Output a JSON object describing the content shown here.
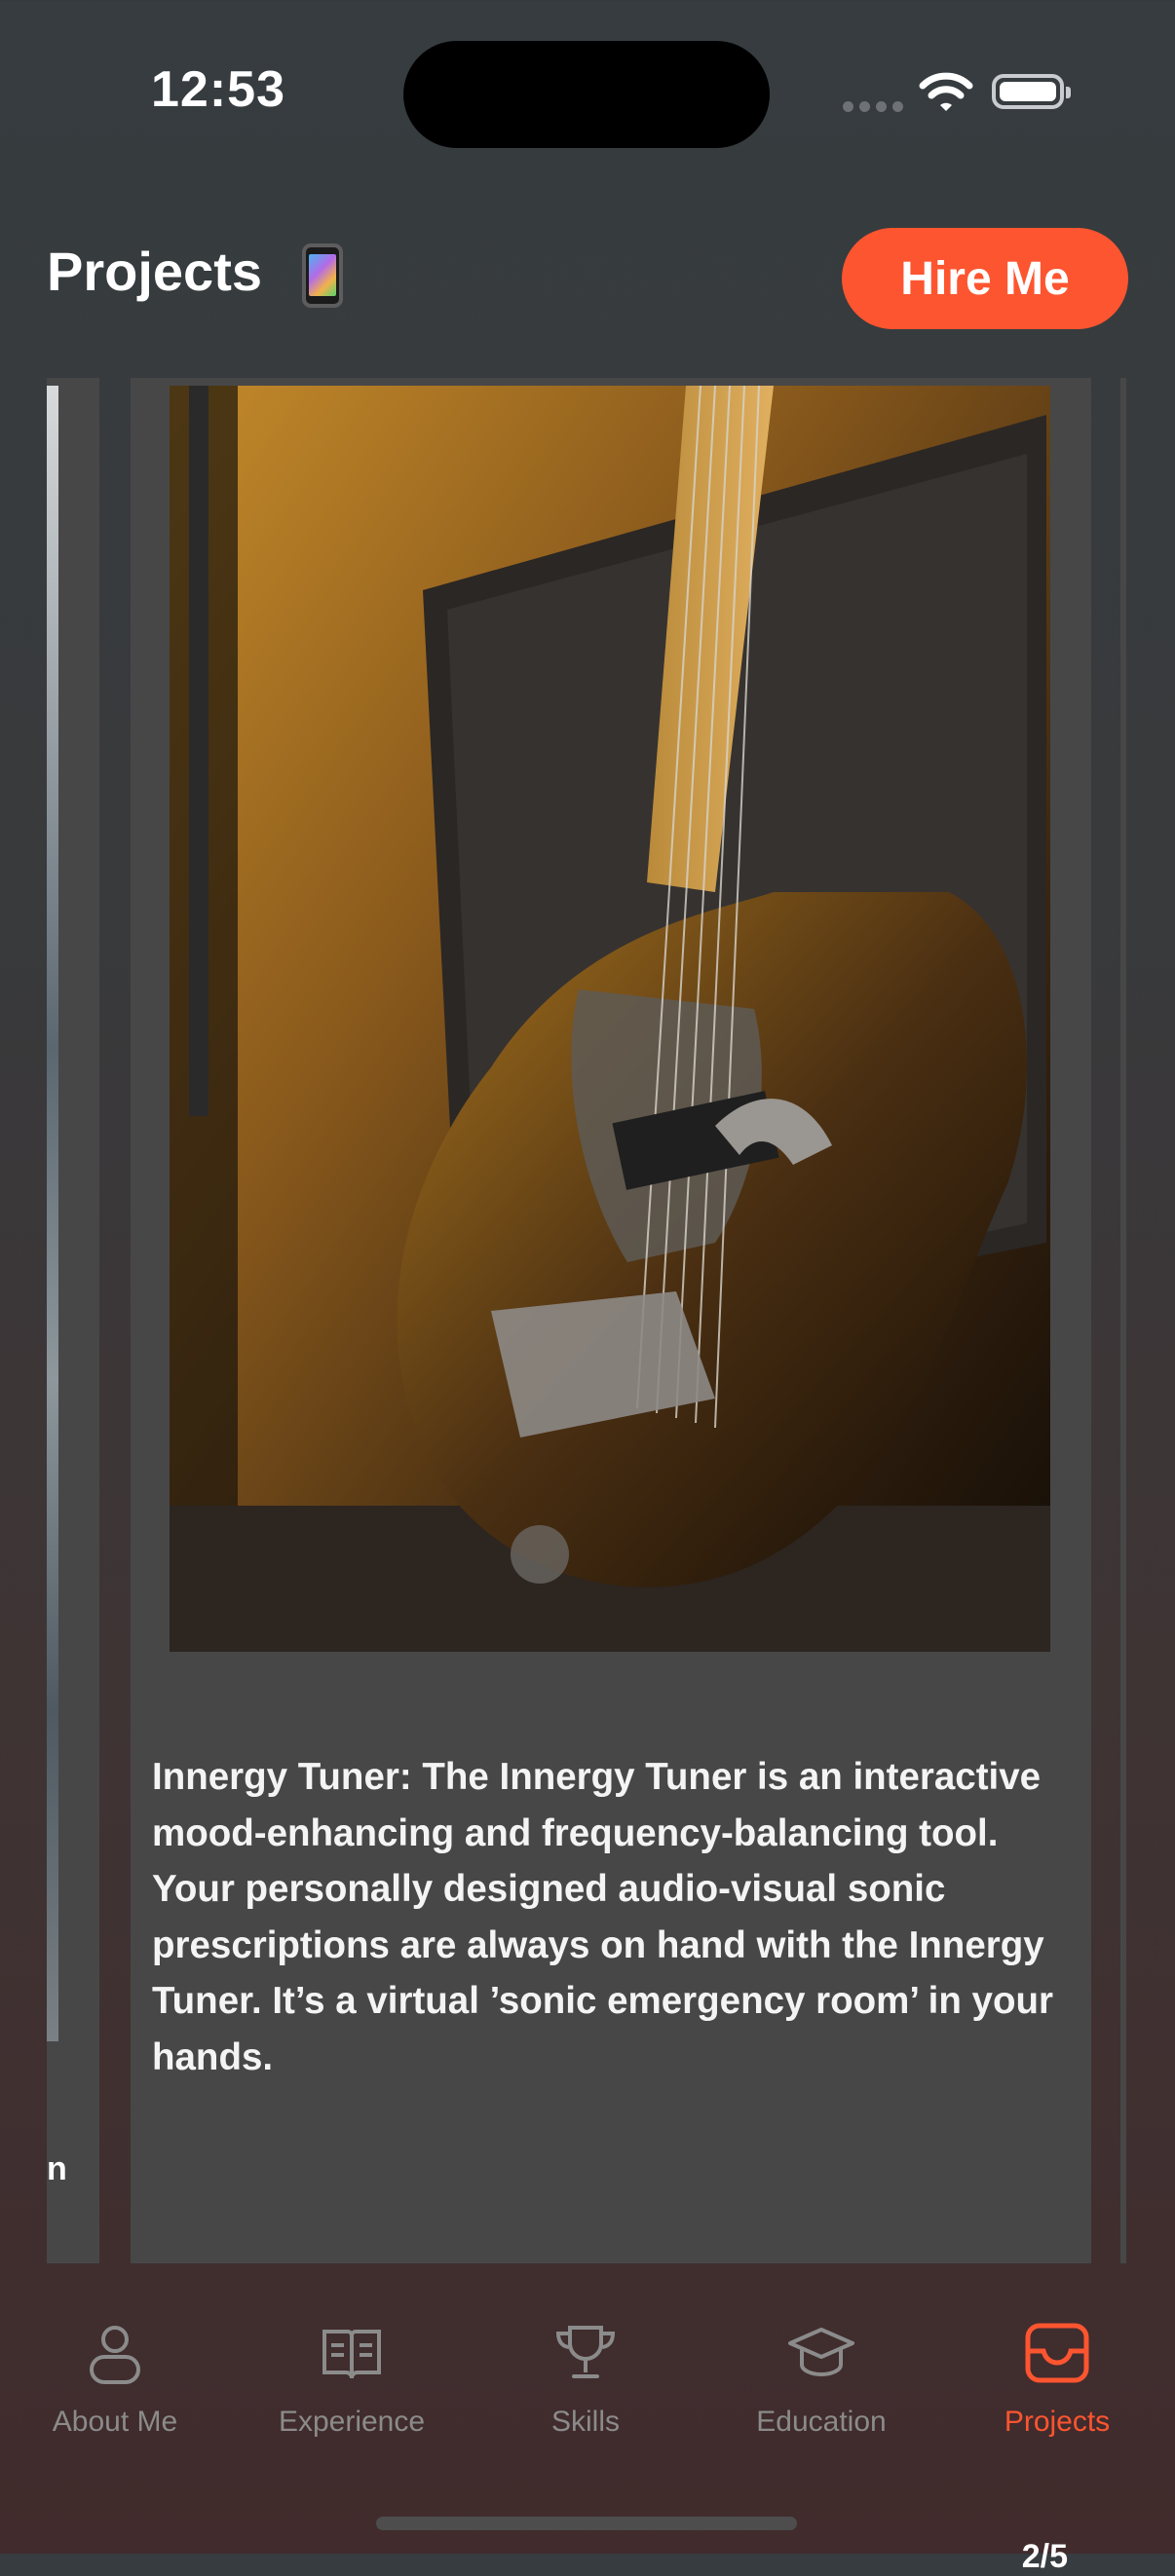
{
  "status_bar": {
    "time": "12:53"
  },
  "header": {
    "title": "Projects",
    "title_icon": "mobile-phone-emoji",
    "hire_button_label": "Hire Me"
  },
  "carousel": {
    "previous_card": {
      "visible_text": "n",
      "counter": "/5"
    },
    "current_card": {
      "image": "electric-guitar-photo",
      "description": "Innergy Tuner: The Innergy Tuner is an interactive mood-enhancing and frequency-balancing tool. Your personally designed audio-visual sonic prescriptions are always on hand with the Innergy Tuner. It’s a virtual ’sonic emergency room’ in your hands.",
      "counter": "2/5"
    }
  },
  "tabbar": {
    "items": [
      {
        "label": "About Me",
        "icon": "person-icon",
        "active": false
      },
      {
        "label": "Experience",
        "icon": "book-icon",
        "active": false
      },
      {
        "label": "Skills",
        "icon": "trophy-icon",
        "active": false
      },
      {
        "label": "Education",
        "icon": "graduation-cap-icon",
        "active": false
      },
      {
        "label": "Projects",
        "icon": "inbox-icon",
        "active": true
      }
    ]
  },
  "colors": {
    "accent": "#fd5530",
    "card_background": "#474747",
    "inactive_tab": "#8b8b8b"
  }
}
